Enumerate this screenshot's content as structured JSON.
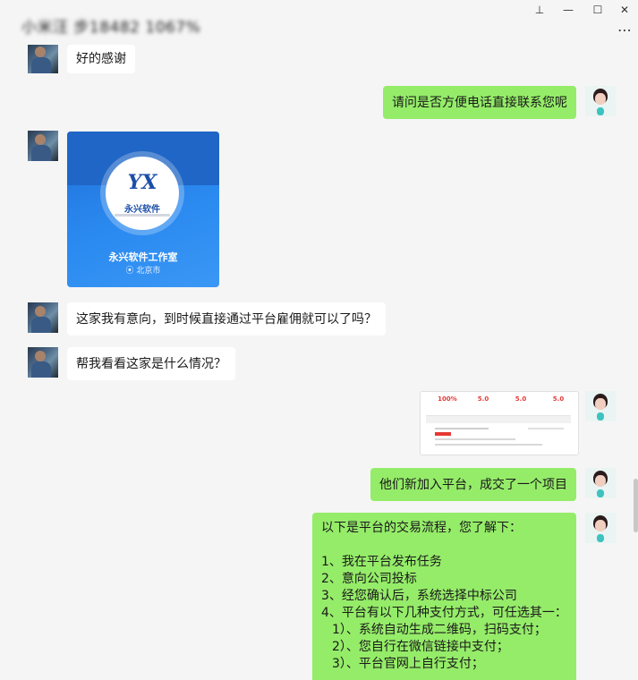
{
  "window": {
    "title": "小米汪 步18482 1067%",
    "controls": {
      "pin": "⊥",
      "minimize": "—",
      "maximize": "☐",
      "close": "✕",
      "more": "⋯"
    }
  },
  "messages": [
    {
      "side": "left",
      "text": "好的感谢"
    },
    {
      "side": "right",
      "text": "请问是否方便电话直接联系您呢"
    },
    {
      "side": "left",
      "type": "card",
      "card": {
        "logo_mark": "YX",
        "logo_text": "永兴软件",
        "name": "永兴软件工作室",
        "location": "北京市"
      }
    },
    {
      "side": "left",
      "text": "这家我有意向，到时候直接通过平台雇佣就可以了吗？"
    },
    {
      "side": "left",
      "text": "帮我看看这家是什么情况？"
    },
    {
      "side": "right",
      "type": "screenshot",
      "stats": [
        "100%",
        "5.0",
        "5.0",
        "5.0"
      ]
    },
    {
      "side": "right",
      "text": "他们新加入平台，成交了一个项目"
    },
    {
      "side": "right",
      "type": "long",
      "lines": [
        "以下是平台的交易流程，您了解下：",
        "",
        "1、我在平台发布任务",
        "2、意向公司投标",
        "3、经您确认后，系统选择中标公司",
        "4、平台有以下几种支付方式，可任选其一：",
        "  1）、系统自动生成二维码，扫码支付；",
        "  2）、您自行在微信链接中支付；",
        "  3）、平台官网上自行支付；"
      ]
    }
  ]
}
